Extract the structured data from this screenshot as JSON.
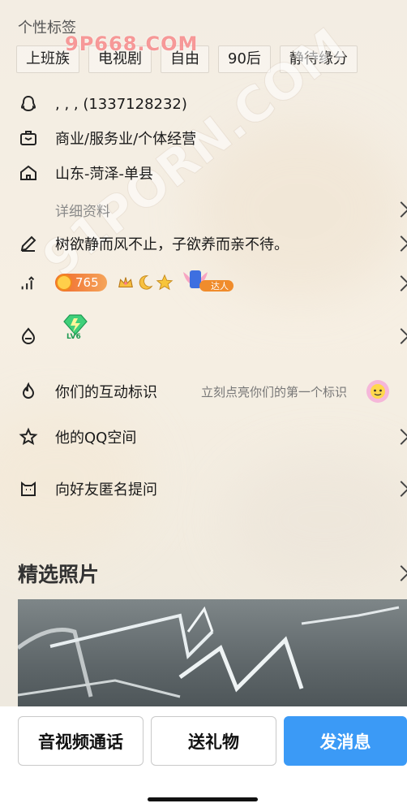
{
  "watermark": {
    "site1": "9P668.COM",
    "site2": "91PORN.COM"
  },
  "tags_section": {
    "title": "个性标签",
    "tags": [
      "上班族",
      "电视剧",
      "自由",
      "90后",
      "静待缘分"
    ]
  },
  "profile": {
    "qq": ", , ,   (1337128232)",
    "occupation": "商业/服务业/个体经营",
    "location": "山东-菏泽-单县",
    "details_label": "详细资料",
    "signature": "树欲静而风不止，子欲养而亲不待。",
    "level_points": "765",
    "wings_label": "达人",
    "level_badge": "LV6"
  },
  "menu": {
    "interaction_label": "你们的互动标识",
    "interaction_hint": "立刻点亮你们的第一个标识",
    "qzone_label": "他的QQ空间",
    "anon_question_label": "向好友匿名提问"
  },
  "photos": {
    "title": "精选照片"
  },
  "actions": {
    "call": "音视频通话",
    "gift": "送礼物",
    "message": "发消息"
  },
  "colors": {
    "primary": "#3b9af6",
    "points_badge": "#f06a2c",
    "background": "#f3ede3"
  }
}
